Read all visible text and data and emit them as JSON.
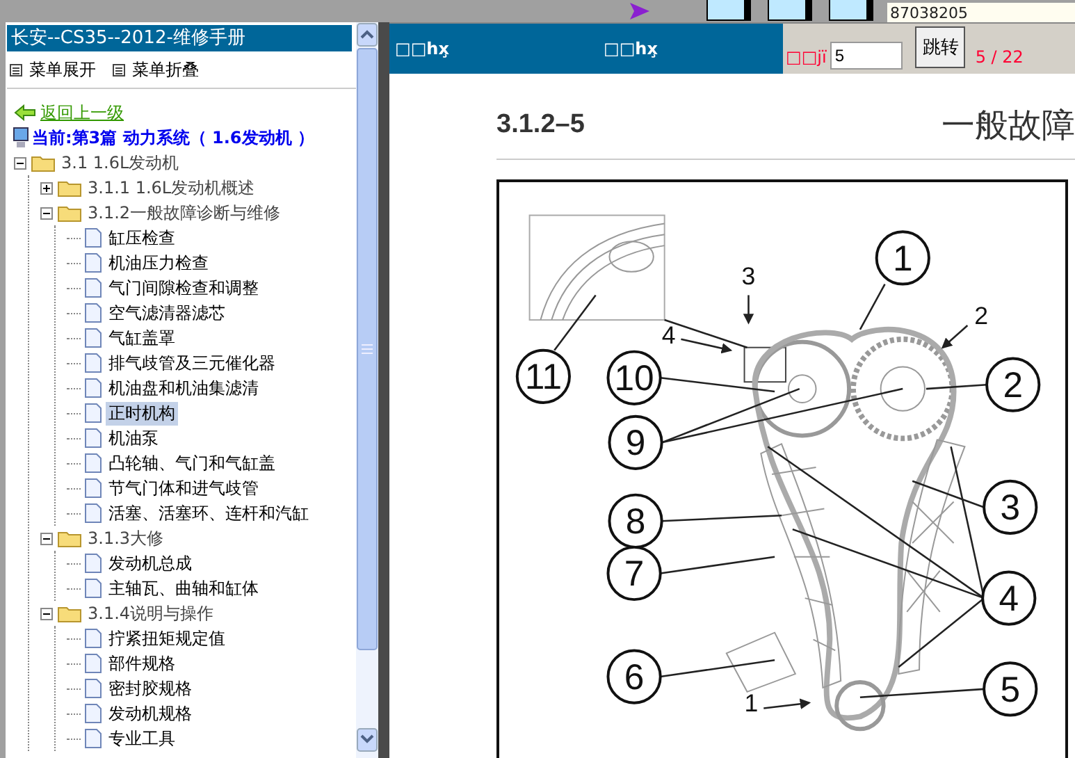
{
  "top_bar": {
    "code": "87038205"
  },
  "sidebar": {
    "title": "长安--CS35--2012-维修手册",
    "menu_actions": [
      "菜单展开",
      "菜单折叠"
    ],
    "back_link": "返回上一级",
    "current": "当前:第3篇 动力系统（ 1.6发动机 ）",
    "tree": [
      {
        "label": "3.1 1.6L发动机",
        "kind": "folder",
        "expanded": true,
        "children": [
          {
            "label": "3.1.1 1.6L发动机概述",
            "kind": "folder",
            "expanded": false
          },
          {
            "label": "3.1.2一般故障诊断与维修",
            "kind": "folder",
            "expanded": true,
            "children": [
              {
                "label": "缸压检查",
                "kind": "page",
                "selected": false
              },
              {
                "label": "机油压力检查",
                "kind": "page",
                "selected": false
              },
              {
                "label": "气门间隙检查和调整",
                "kind": "page",
                "selected": false
              },
              {
                "label": "空气滤清器滤芯",
                "kind": "page",
                "selected": false
              },
              {
                "label": "气缸盖罩",
                "kind": "page",
                "selected": false
              },
              {
                "label": "排气歧管及三元催化器",
                "kind": "page",
                "selected": false
              },
              {
                "label": "机油盘和机油集滤清",
                "kind": "page",
                "selected": false
              },
              {
                "label": "正时机构",
                "kind": "page",
                "selected": true
              },
              {
                "label": "机油泵",
                "kind": "page",
                "selected": false
              },
              {
                "label": "凸轮轴、气门和气缸盖",
                "kind": "page",
                "selected": false
              },
              {
                "label": "节气门体和进气歧管",
                "kind": "page",
                "selected": false
              },
              {
                "label": "活塞、活塞环、连杆和汽缸",
                "kind": "page",
                "selected": false
              }
            ]
          },
          {
            "label": "3.1.3大修",
            "kind": "folder",
            "expanded": true,
            "children": [
              {
                "label": "发动机总成",
                "kind": "page",
                "selected": false
              },
              {
                "label": "主轴瓦、曲轴和缸体",
                "kind": "page",
                "selected": false
              }
            ]
          },
          {
            "label": "3.1.4说明与操作",
            "kind": "folder",
            "expanded": true,
            "children": [
              {
                "label": "拧紧扭矩规定值",
                "kind": "page",
                "selected": false
              },
              {
                "label": "部件规格",
                "kind": "page",
                "selected": false
              },
              {
                "label": "密封胶规格",
                "kind": "page",
                "selected": false
              },
              {
                "label": "发动机规格",
                "kind": "page",
                "selected": false
              },
              {
                "label": "专业工具",
                "kind": "page",
                "selected": false
              }
            ]
          }
        ]
      }
    ]
  },
  "viewer": {
    "header": {
      "title_1": "□□hx̧",
      "title_2": "□□hx̧",
      "page_label": "□□jï",
      "page_input": "5",
      "go_button": "跳转",
      "page_count": "5 / 22"
    },
    "document": {
      "section_number": "3.1.2–5",
      "heading": "一般故障",
      "callouts": [
        {
          "label": "1",
          "kind": "circled"
        },
        {
          "label": "3",
          "kind": "plain"
        },
        {
          "label": "2",
          "kind": "plain"
        },
        {
          "label": "4",
          "kind": "plain"
        },
        {
          "label": "11",
          "kind": "circled"
        },
        {
          "label": "10",
          "kind": "circled"
        },
        {
          "label": "2",
          "kind": "circled"
        },
        {
          "label": "9",
          "kind": "circled"
        },
        {
          "label": "3",
          "kind": "circled"
        },
        {
          "label": "8",
          "kind": "circled"
        },
        {
          "label": "7",
          "kind": "circled"
        },
        {
          "label": "4",
          "kind": "circled"
        },
        {
          "label": "6",
          "kind": "circled"
        },
        {
          "label": "5",
          "kind": "circled"
        },
        {
          "label": "1",
          "kind": "plain"
        }
      ]
    }
  }
}
